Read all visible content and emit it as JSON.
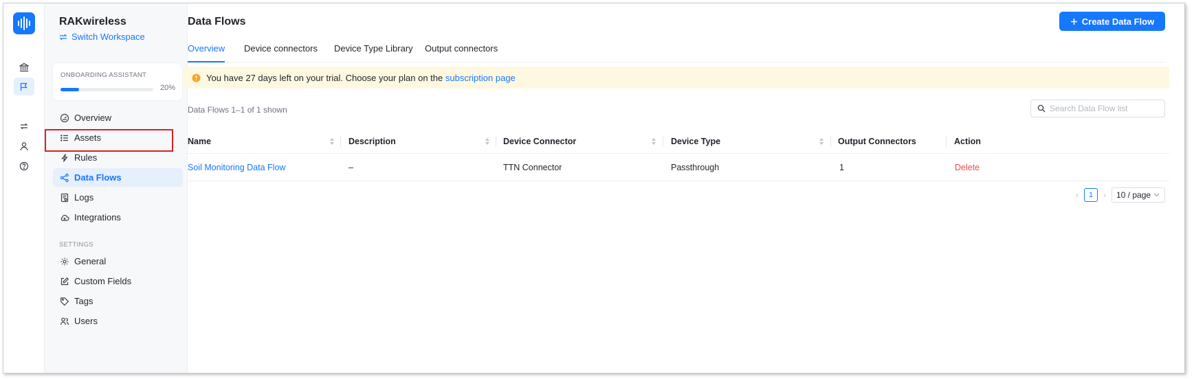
{
  "workspace": {
    "name": "RAKwireless",
    "switch_label": "Switch Workspace"
  },
  "onboarding": {
    "label": "ONBOARDING ASSISTANT",
    "progress_fraction": 0.2,
    "progress_text": "20%"
  },
  "sidebar": {
    "items": [
      {
        "label": "Overview",
        "icon": "dashboard-icon"
      },
      {
        "label": "Assets",
        "icon": "list-icon"
      },
      {
        "label": "Rules",
        "icon": "lightning-icon"
      },
      {
        "label": "Data Flows",
        "icon": "share-icon",
        "active": true
      },
      {
        "label": "Logs",
        "icon": "log-icon"
      },
      {
        "label": "Integrations",
        "icon": "cloud-icon"
      }
    ],
    "settings_label": "SETTINGS",
    "settings_items": [
      {
        "label": "General",
        "icon": "gear-icon"
      },
      {
        "label": "Custom Fields",
        "icon": "edit-icon"
      },
      {
        "label": "Tags",
        "icon": "tag-icon"
      },
      {
        "label": "Users",
        "icon": "users-icon"
      }
    ]
  },
  "rail": {
    "icons": [
      "bank-icon",
      "flag-icon",
      "repeat-icon",
      "user-icon",
      "help-icon"
    ]
  },
  "header": {
    "title": "Data Flows",
    "create_label": "Create Data Flow"
  },
  "tabs": [
    "Overview",
    "Device connectors",
    "Device Type Library",
    "Output connectors"
  ],
  "banner": {
    "text": "You have 27 days left on your trial. Choose your plan on the",
    "link": "subscription page"
  },
  "list": {
    "count_text": "Data Flows 1–1 of 1 shown",
    "search_placeholder": "Search Data Flow list"
  },
  "table": {
    "columns": [
      "Name",
      "Description",
      "Device Connector",
      "Device Type",
      "Output Connectors",
      "Action"
    ],
    "rows": [
      {
        "name": "Soil Monitoring Data Flow",
        "description": "–",
        "device_connector": "TTN Connector",
        "device_type": "Passthrough",
        "output_connectors": "1",
        "action": "Delete"
      }
    ]
  },
  "pagination": {
    "current_page": "1",
    "page_size": "10 / page"
  },
  "colors": {
    "accent": "#1677ff",
    "danger": "#f04a4a",
    "banner_bg": "#fff8e1",
    "warning_icon": "#f5a623",
    "highlight_border": "#e01e1e"
  }
}
